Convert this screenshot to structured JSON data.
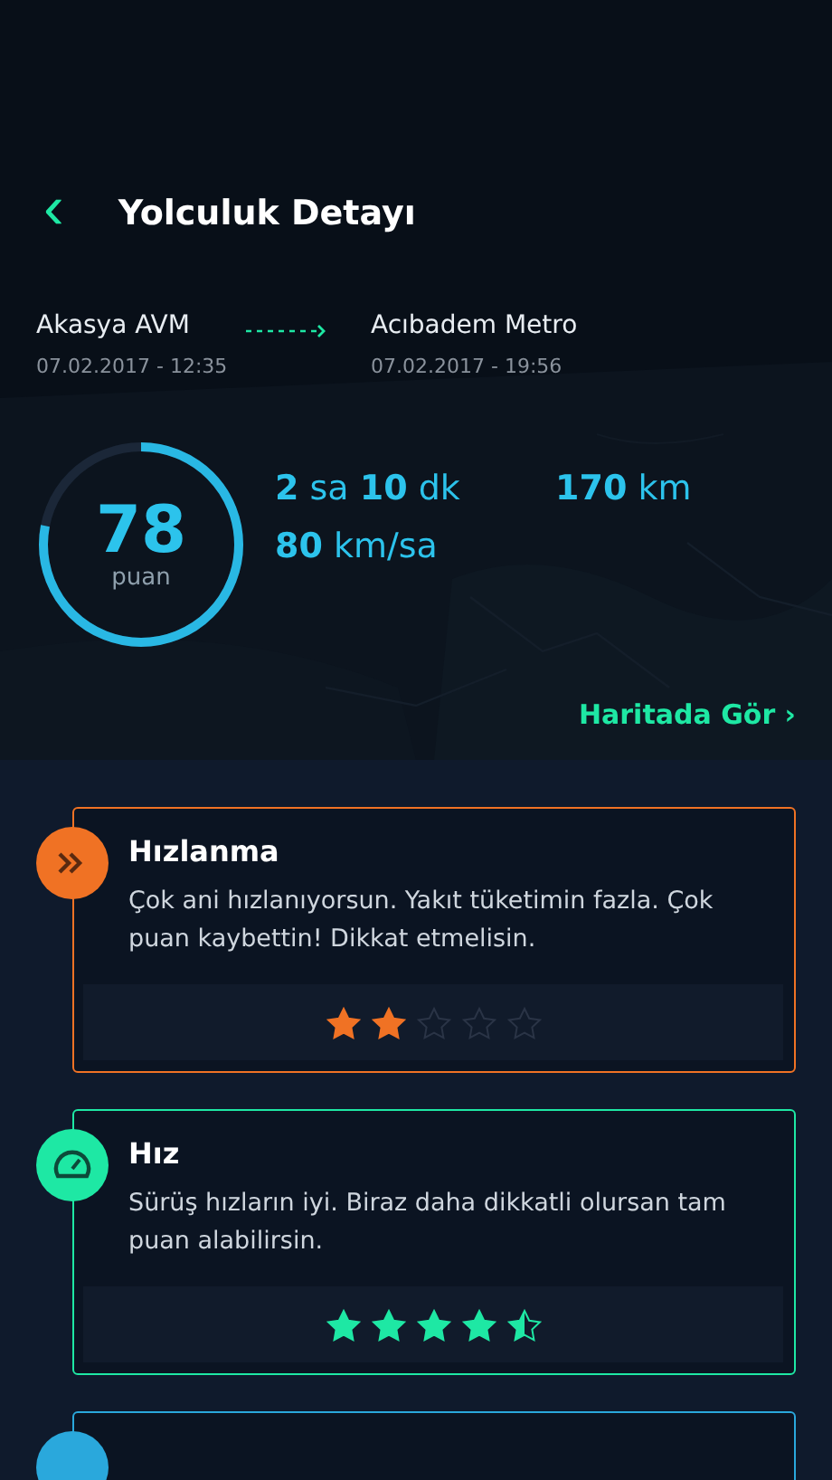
{
  "header": {
    "back": "‹",
    "title": "Yolculuk Detayı"
  },
  "route": {
    "from": {
      "place": "Akasya AVM",
      "time": "07.02.2017 - 12:35"
    },
    "to": {
      "place": "Acıbadem Metro",
      "time": "07.02.2017 - 19:56"
    }
  },
  "score": {
    "value": "78",
    "unit": "puan",
    "level": 0.78
  },
  "stats": [
    "**2** sa **10** dk",
    "**170** km",
    "**80** km/sa"
  ],
  "map_link": {
    "label": "Haritada Gör",
    "chevron": "›"
  },
  "cards": [
    {
      "kind": "acceleration",
      "color": "#f07224",
      "title": "Hızlanma",
      "text": "Çok ani hızlanıyorsun. Yakıt tüketimin fazla. Çok puan kaybettin! Dikkat etmelisin.",
      "stars": 2
    },
    {
      "kind": "speed",
      "color": "#1ee8a4",
      "title": "Hız",
      "text": "Sürüş hızların iyi. Biraz daha dikkatli olursan tam puan alabilirsin.",
      "stars": 4.5
    },
    {
      "kind": "partial",
      "color": "#2aa8dc"
    }
  ]
}
